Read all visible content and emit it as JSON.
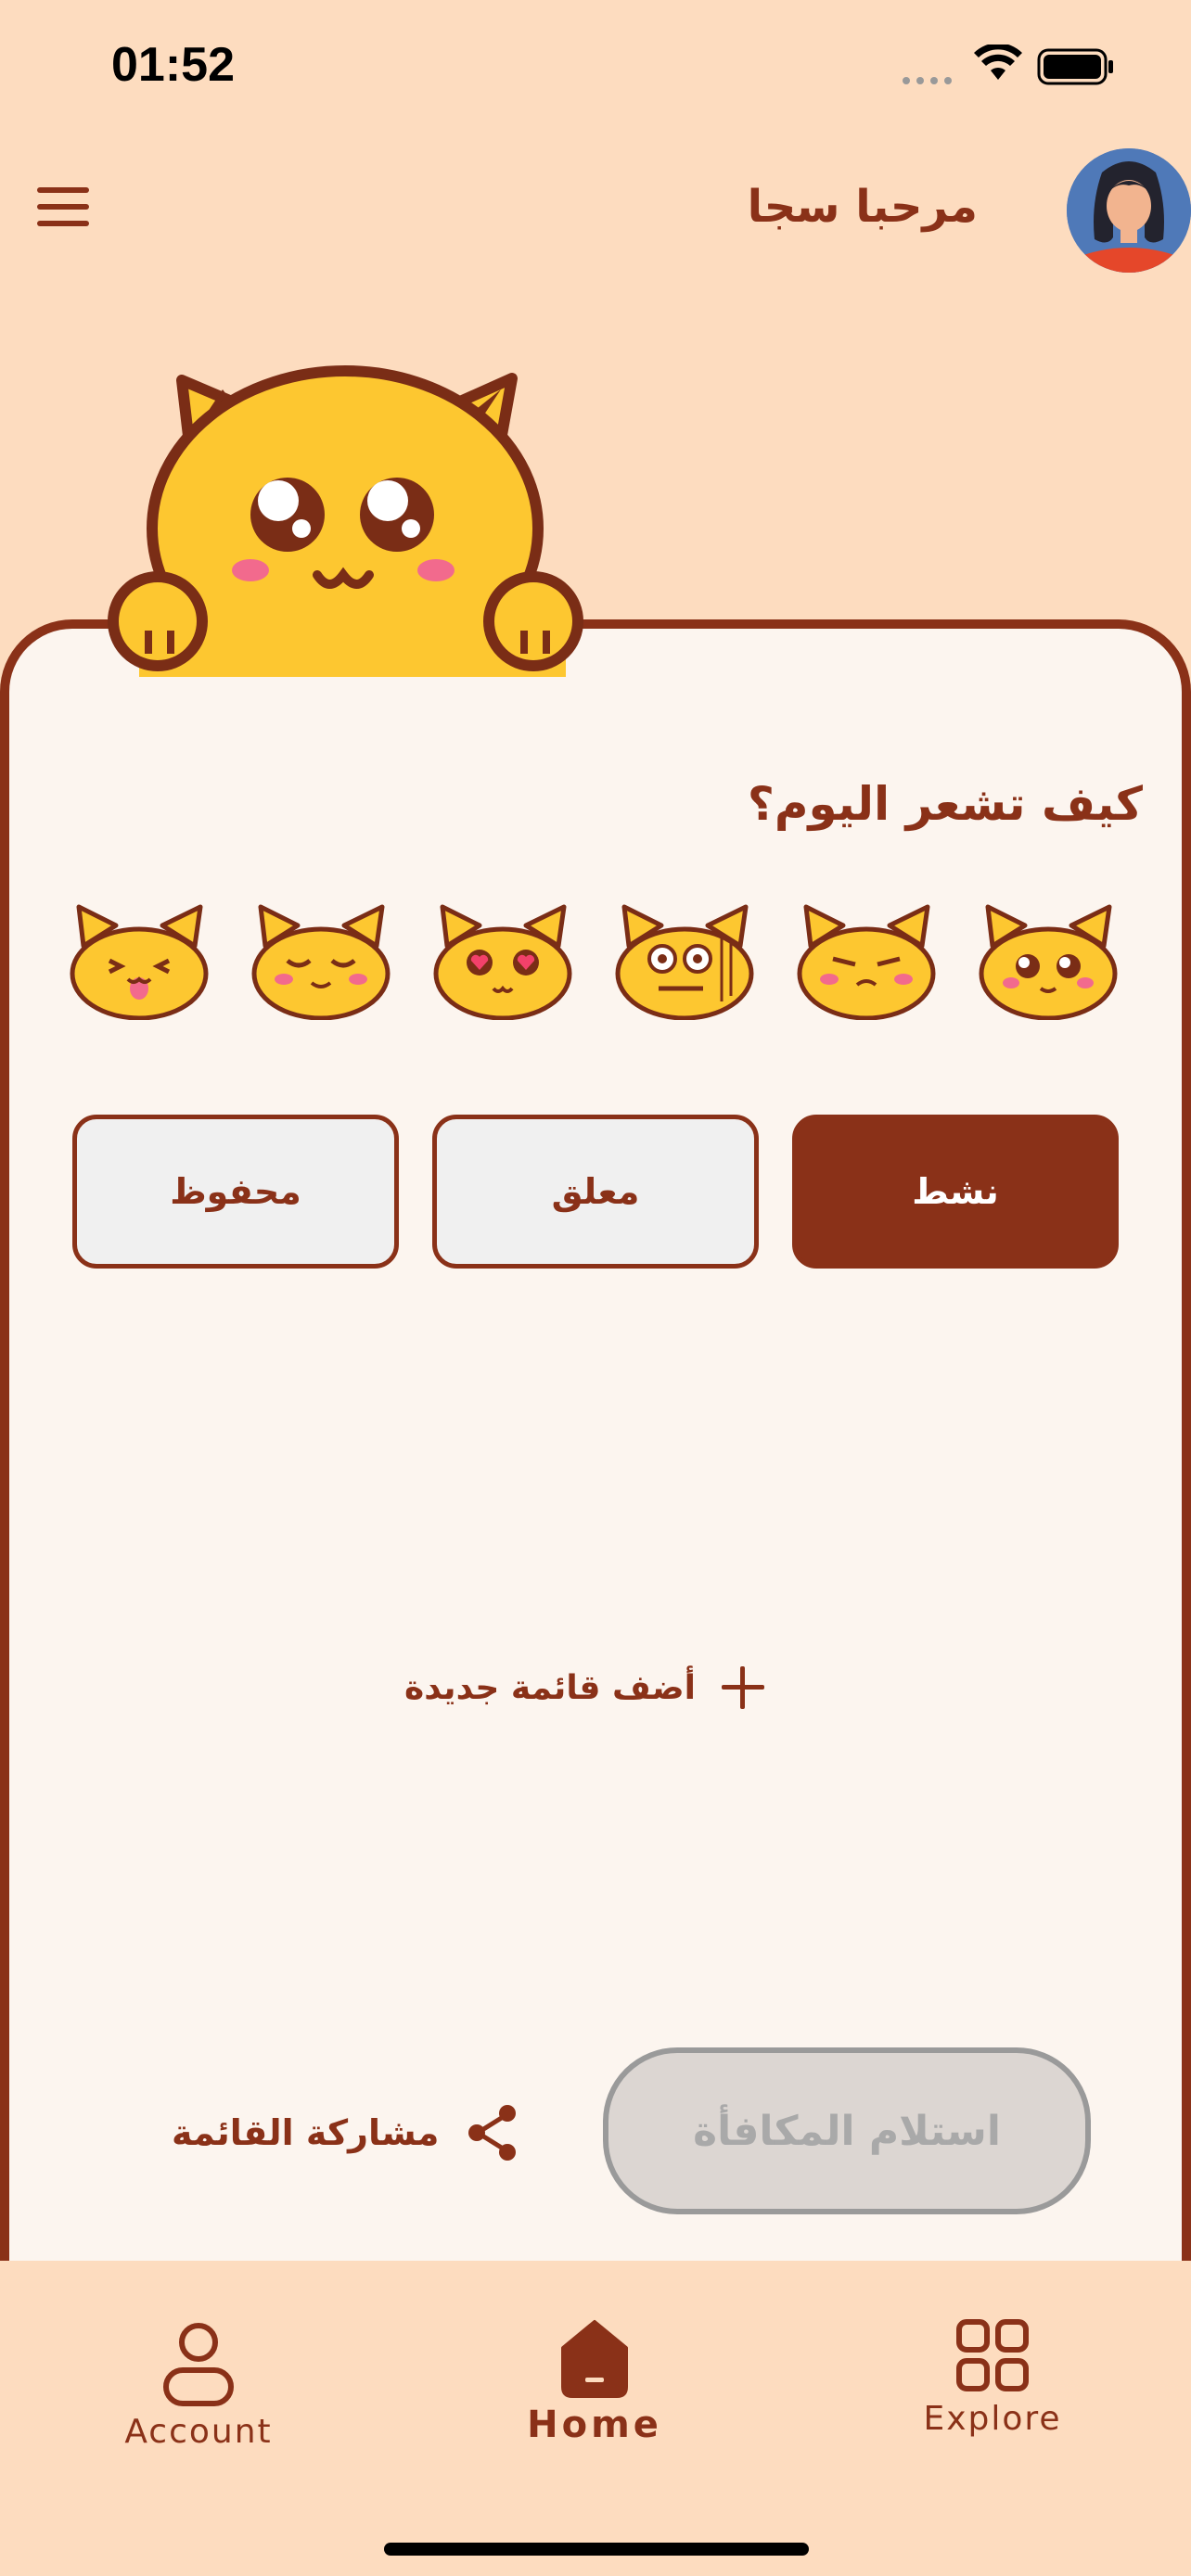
{
  "status_bar": {
    "time": "01:52"
  },
  "header": {
    "greeting": "مرحبا سجا"
  },
  "mood_section": {
    "question": "كيف تشعر اليوم؟",
    "moods": [
      "playful-cat-icon",
      "sleepy-cat-icon",
      "love-cat-icon",
      "dizzy-cat-icon",
      "annoyed-cat-icon",
      "teary-cat-icon"
    ]
  },
  "tabs": {
    "active": "نشط",
    "suspended": "معلق",
    "saved": "محفوظ"
  },
  "add_list": {
    "label": "أضف قائمة جديدة"
  },
  "actions": {
    "share_label": "مشاركة القائمة",
    "reward_label": "استلام المكافأة"
  },
  "bottom_nav": {
    "account": "Account",
    "home": "Home",
    "explore": "Explore"
  },
  "colors": {
    "primary": "#8a3118",
    "background": "#fddcbf",
    "card": "#fcf5ef",
    "cat_yellow": "#fdc730"
  }
}
